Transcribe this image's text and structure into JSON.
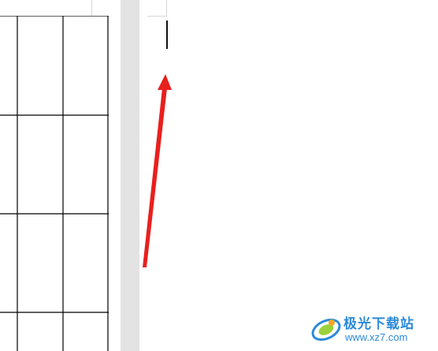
{
  "document": {
    "left_page": {
      "table": {
        "columns": 3,
        "rows_visible": 4
      }
    },
    "right_page": {
      "cursor": "text-cursor"
    }
  },
  "annotation": {
    "arrow_color": "#e8201e"
  },
  "watermark": {
    "title": "极光下载站",
    "url": "www.xz7.com",
    "brand_color": "#2b8ad8"
  }
}
